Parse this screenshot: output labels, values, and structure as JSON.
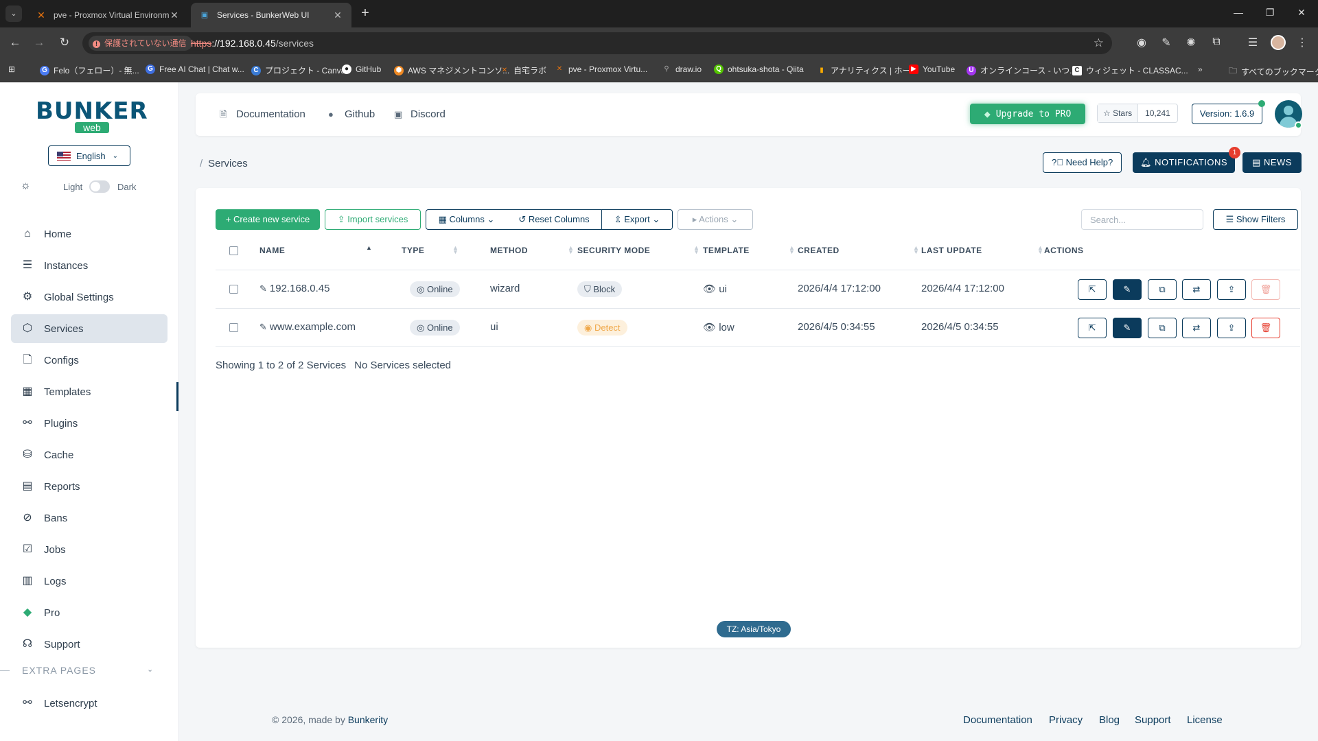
{
  "browser": {
    "tabs": [
      {
        "title": "pve - Proxmox Virtual Environm",
        "icon": "proxmox-icon",
        "active": false
      },
      {
        "title": "Services - BunkerWeb UI",
        "icon": "bunkerweb-icon",
        "active": true
      }
    ],
    "security_chip": "保護されていない通信",
    "url_scheme": "https",
    "url_host": "://192.168.0.45",
    "url_path": "/services",
    "bookmarks": [
      {
        "label": "Felo（フェロー）- 無...",
        "color": "#4a7cf5"
      },
      {
        "label": "Free AI Chat | Chat w...",
        "color": "#3f6fe0"
      },
      {
        "label": "プロジェクト - Canva",
        "color": "#3a7bd5"
      },
      {
        "label": "GitHub",
        "color": "#ffffff"
      },
      {
        "label": "AWS マネジメントコンソ...",
        "color": "#f08a24"
      },
      {
        "label": "自宅ラボ",
        "color": "#e8730e"
      },
      {
        "label": "pve - Proxmox Virtu...",
        "color": "#e8730e"
      },
      {
        "label": "draw.io",
        "color": "#888888"
      },
      {
        "label": "ohtsuka-shota - Qiita",
        "color": "#55c500"
      },
      {
        "label": "アナリティクス | ホーム",
        "color": "#f9ab00"
      },
      {
        "label": "YouTube",
        "color": "#ff0000"
      },
      {
        "label": "オンラインコース - いつ...",
        "color": "#a435f0"
      },
      {
        "label": "ウィジェット - CLASSAC...",
        "color": "#ffffff"
      }
    ],
    "all_bookmarks": "すべてのブックマーク"
  },
  "sidebar": {
    "logo_main": "BUNKER",
    "logo_sub": "web",
    "language": "English",
    "theme_light": "Light",
    "theme_dark": "Dark",
    "items": [
      {
        "label": "Home",
        "icon": "⌂"
      },
      {
        "label": "Instances",
        "icon": "☰"
      },
      {
        "label": "Global Settings",
        "icon": "⚙"
      },
      {
        "label": "Services",
        "icon": "⬡"
      },
      {
        "label": "Configs",
        "icon": "🗋"
      },
      {
        "label": "Templates",
        "icon": "▦"
      },
      {
        "label": "Plugins",
        "icon": "⚯"
      },
      {
        "label": "Cache",
        "icon": "⛁"
      },
      {
        "label": "Reports",
        "icon": "▤"
      },
      {
        "label": "Bans",
        "icon": "⊘"
      },
      {
        "label": "Jobs",
        "icon": "☑"
      },
      {
        "label": "Logs",
        "icon": "▥"
      },
      {
        "label": "Pro",
        "icon": "◆"
      },
      {
        "label": "Support",
        "icon": "☊"
      }
    ],
    "extra_title": "EXTRA PAGES",
    "extra_items": [
      {
        "label": "Letsencrypt",
        "icon": "⚯"
      }
    ]
  },
  "header": {
    "links": [
      "Documentation",
      "Github",
      "Discord"
    ],
    "upgrade": "Upgrade to PRO",
    "stars_label": "Stars",
    "stars_count": "10,241",
    "version": "Version: 1.6.9"
  },
  "breadcrumb": {
    "sep": "/",
    "current": "Services"
  },
  "actions_bar": {
    "need_help": "Need Help?",
    "notifications": "NOTIFICATIONS",
    "notif_count": "1",
    "news": "NEWS"
  },
  "toolbar": {
    "create": "Create new service",
    "import": "Import services",
    "columns": "Columns",
    "reset": "Reset Columns",
    "export": "Export",
    "actions": "Actions",
    "search_placeholder": "Search...",
    "filters": "Show Filters"
  },
  "table": {
    "headers": [
      "NAME",
      "TYPE",
      "METHOD",
      "SECURITY MODE",
      "TEMPLATE",
      "CREATED",
      "LAST UPDATE",
      "ACTIONS"
    ],
    "rows": [
      {
        "name": "192.168.0.45",
        "type": "Online",
        "method": "wizard",
        "security": "Block",
        "template": "ui",
        "created": "2026/4/4 17:12:00",
        "updated": "2026/4/4 17:12:00"
      },
      {
        "name": "www.example.com",
        "type": "Online",
        "method": "ui",
        "security": "Detect",
        "template": "low",
        "created": "2026/4/5 0:34:55",
        "updated": "2026/4/5 0:34:55"
      }
    ],
    "showing": "Showing 1 to 2 of 2 Services",
    "selected": "No Services selected"
  },
  "timezone": "TZ: Asia/Tokyo",
  "footer": {
    "copy": "© 2026, made by ",
    "by": "Bunkerity",
    "links": [
      "Documentation",
      "Privacy",
      "Blog",
      "Support",
      "License"
    ]
  },
  "colors": {
    "accent": "#2dab74",
    "primary": "#0b3b5c",
    "danger": "#e63d2e",
    "warning": "#f0a84a"
  }
}
